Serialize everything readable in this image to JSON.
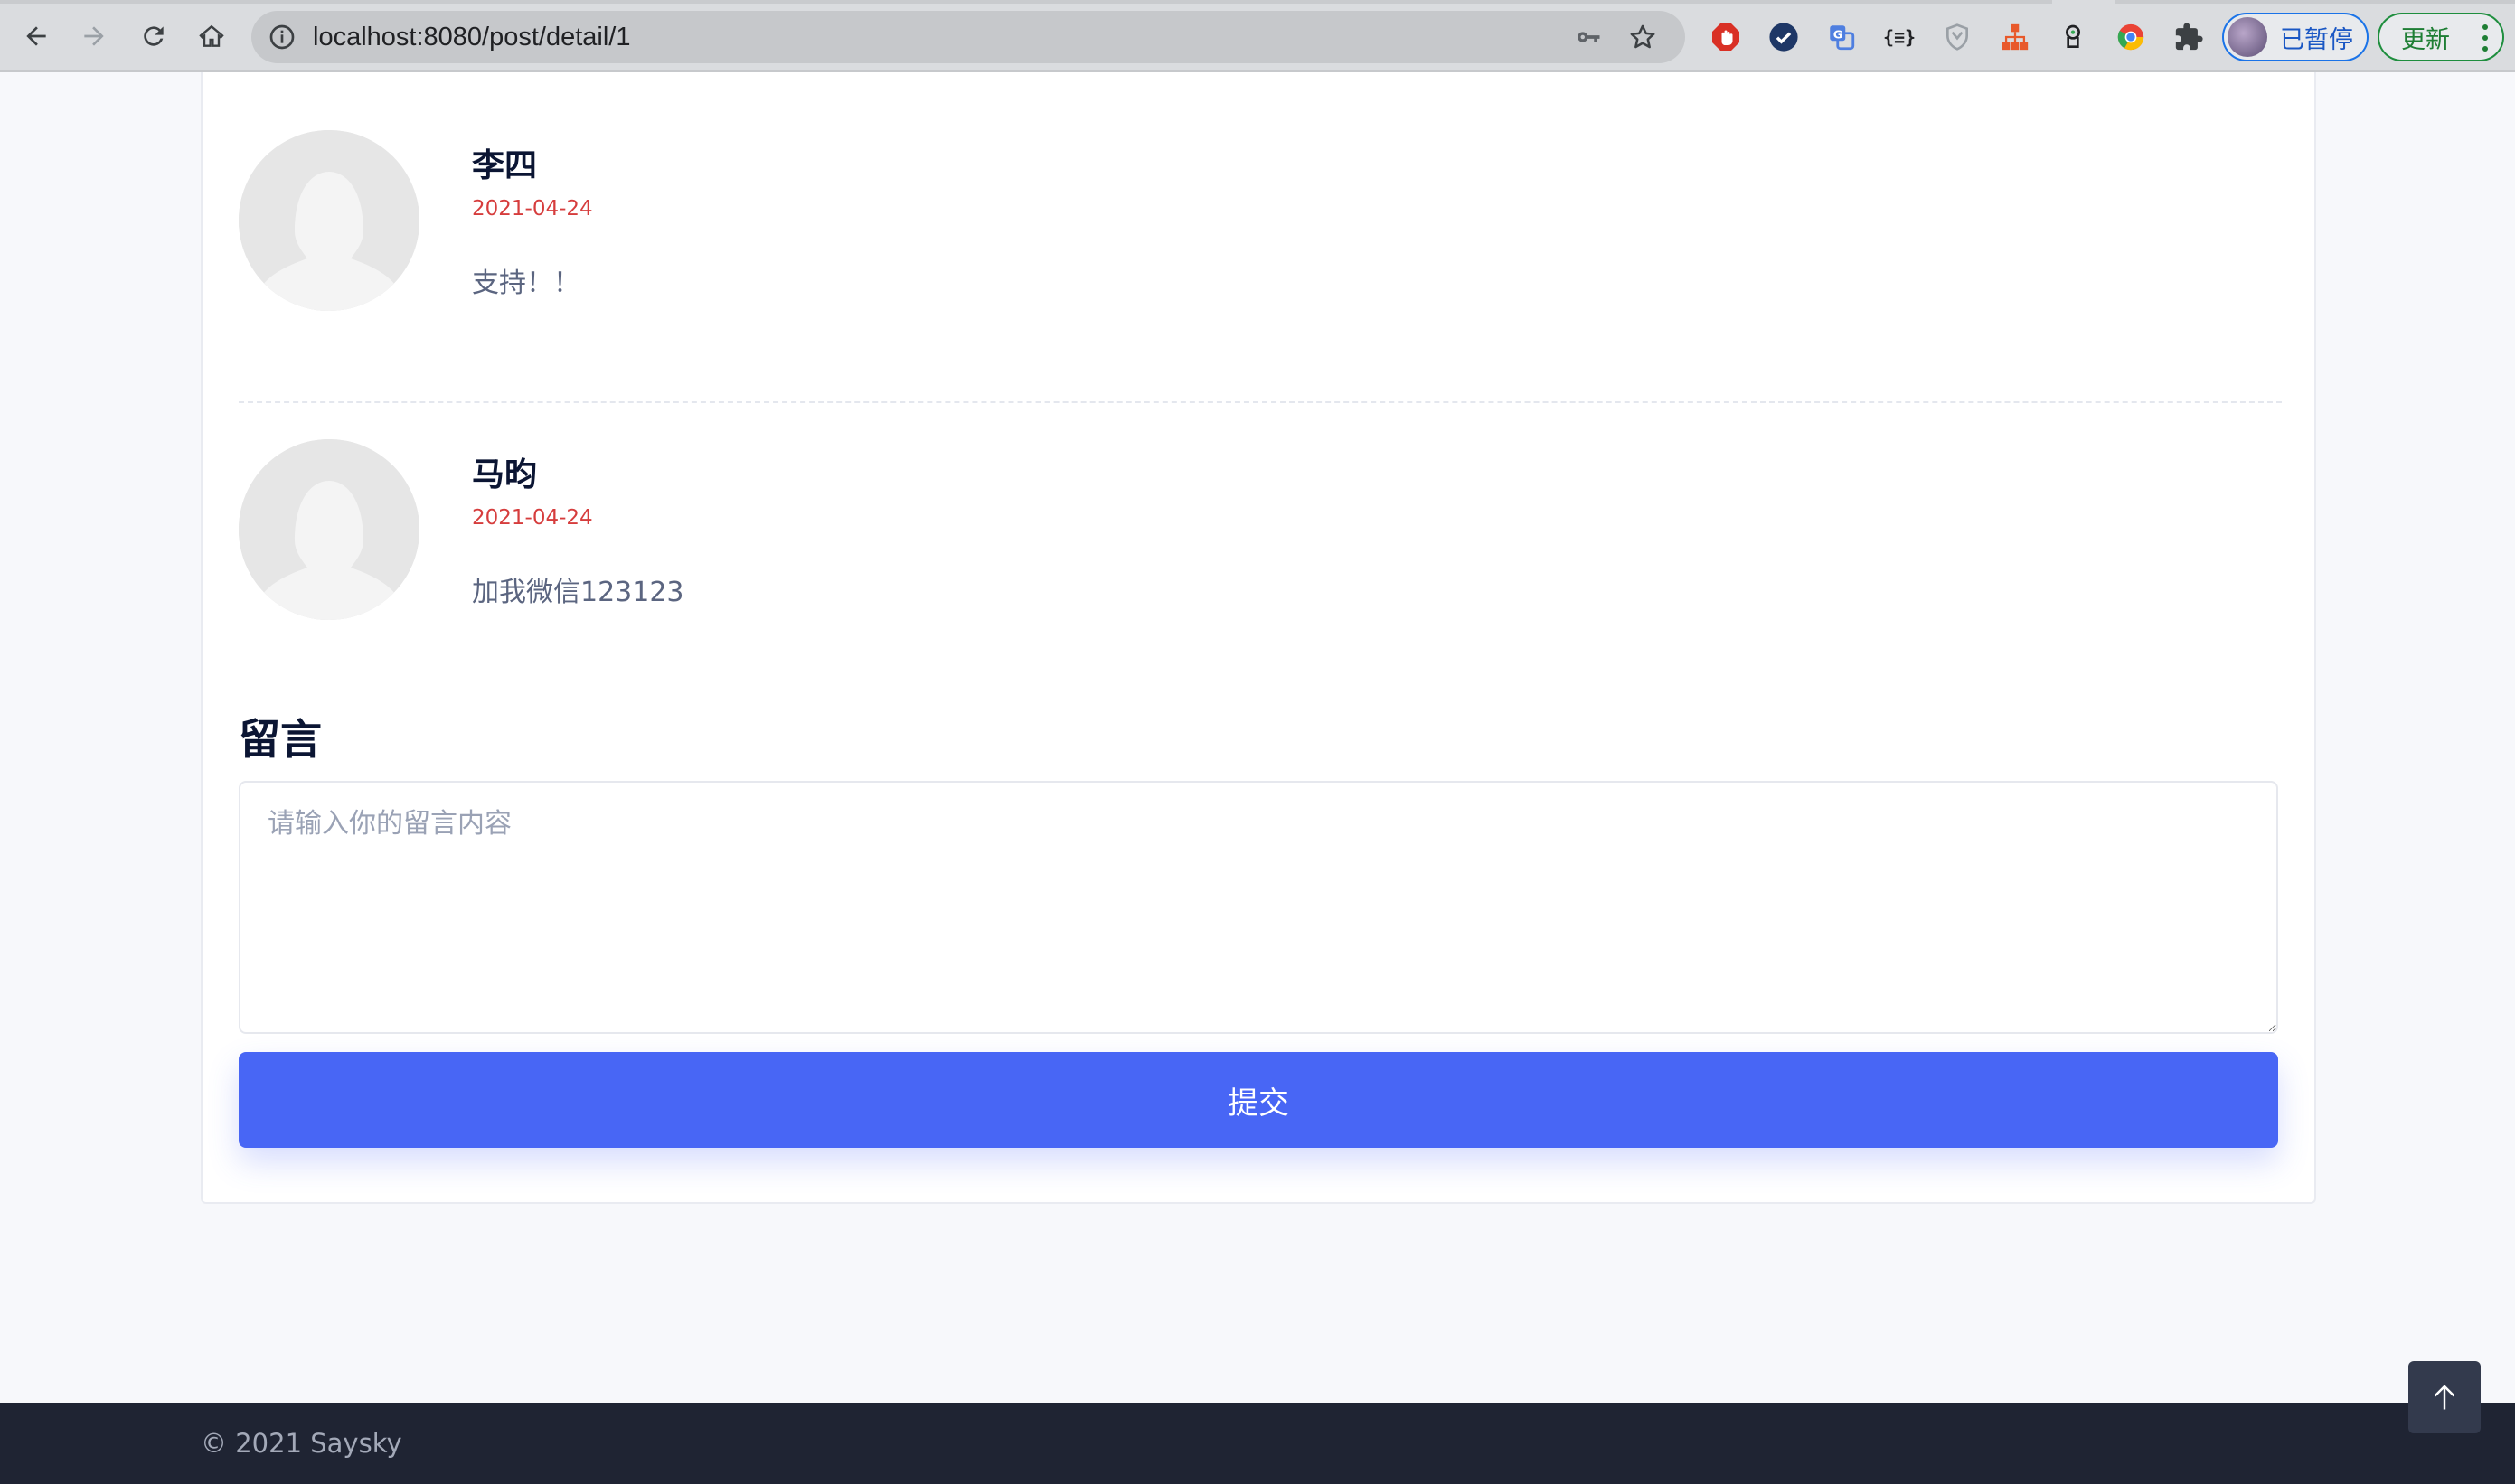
{
  "browser": {
    "url": "localhost:8080/post/detail/1",
    "profile_label": "已暂停",
    "update_label": "更新",
    "extensions": [
      "adblock-icon",
      "checkmark-shield-icon",
      "translate-icon",
      "json-viewer-icon",
      "shield-outline-icon",
      "sitemap-icon",
      "tampermonkey-icon",
      "chrome-color-icon",
      "puzzle-extensions-icon"
    ]
  },
  "comments": [
    {
      "name": "李四",
      "date": "2021-04-24",
      "text": "支持！！"
    },
    {
      "name": "马昀",
      "date": "2021-04-24",
      "text": "加我微信123123"
    }
  ],
  "message_form": {
    "title": "留言",
    "placeholder": "请输入你的留言内容",
    "value": "",
    "submit_label": "提交"
  },
  "footer": {
    "copyright": "© 2021 Saysky"
  },
  "colors": {
    "accent": "#4866f5",
    "date": "#d63d3d",
    "footer_bg": "#1f2433"
  }
}
